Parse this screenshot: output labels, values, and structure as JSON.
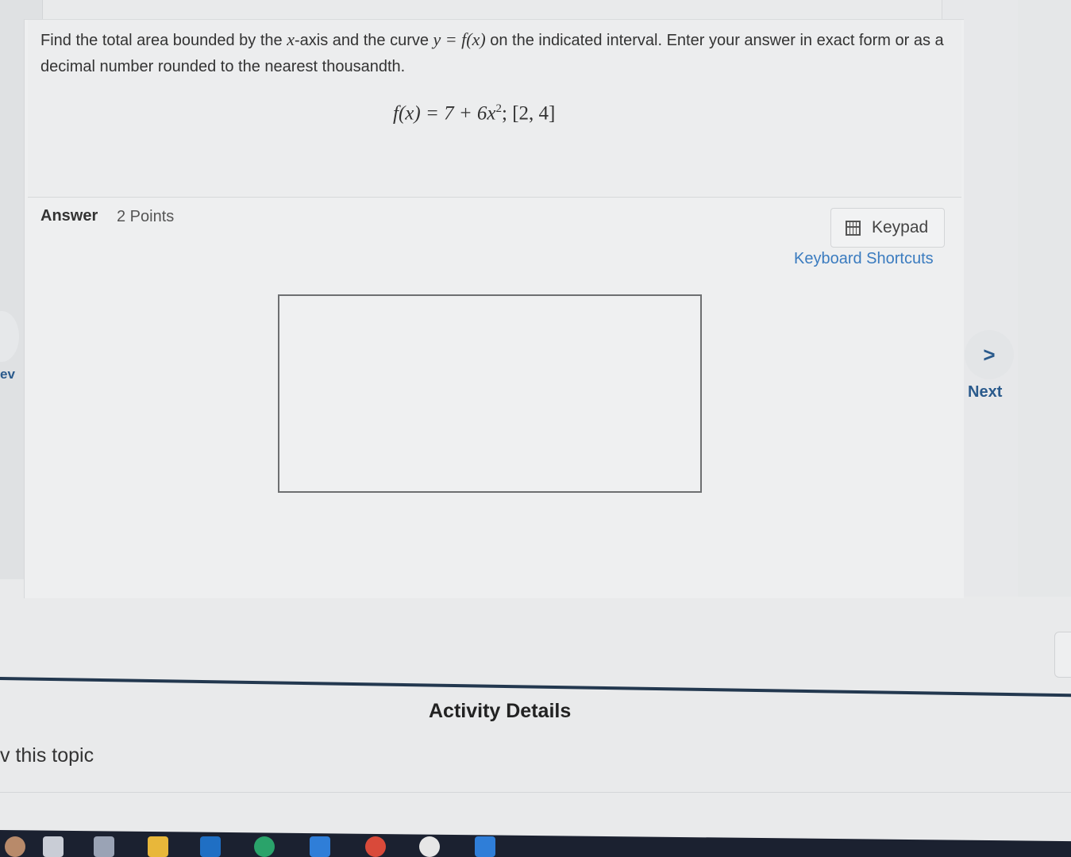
{
  "question": {
    "text_before": "Find the total area bounded by the ",
    "x_var": "x",
    "text_mid1": "-axis and the curve ",
    "curve_eq": "y = f(x)",
    "text_after": " on the indicated interval. Enter your answer in exact form or as a decimal number rounded to the nearest thousandth.",
    "formula_lhs": "f(x) = 7 + 6x",
    "formula_exp": "2",
    "formula_rhs": "; [2, 4]"
  },
  "answer": {
    "label": "Answer",
    "points": "2 Points",
    "keypad_label": "Keypad",
    "shortcuts_label": "Keyboard Shortcuts",
    "input_value": ""
  },
  "nav": {
    "prev_label": "ev",
    "next_symbol": ">",
    "next_label": "Next"
  },
  "bottom": {
    "activity_title": "Activity Details",
    "topic_text": "v this topic"
  },
  "colors": {
    "link": "#3a7bbf",
    "nav": "#2a5a8c",
    "divider": "#23384f",
    "taskbar": "#1b2130"
  }
}
